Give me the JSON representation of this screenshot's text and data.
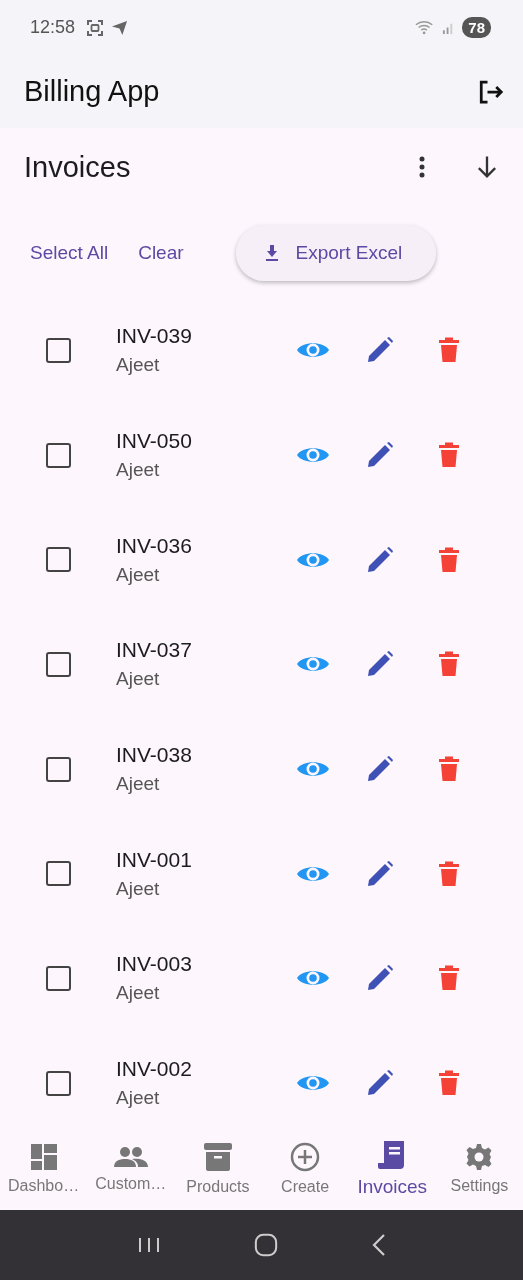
{
  "status_bar": {
    "time": "12:58",
    "battery": "78"
  },
  "app_bar": {
    "title": "Billing App"
  },
  "page": {
    "title": "Invoices"
  },
  "actions": {
    "select_all": "Select All",
    "clear": "Clear",
    "export": "Export Excel"
  },
  "invoices": [
    {
      "number": "INV-039",
      "customer": "Ajeet",
      "checked": false
    },
    {
      "number": "INV-050",
      "customer": "Ajeet",
      "checked": false
    },
    {
      "number": "INV-036",
      "customer": "Ajeet",
      "checked": false
    },
    {
      "number": "INV-037",
      "customer": "Ajeet",
      "checked": false
    },
    {
      "number": "INV-038",
      "customer": "Ajeet",
      "checked": false
    },
    {
      "number": "INV-001",
      "customer": "Ajeet",
      "checked": false
    },
    {
      "number": "INV-003",
      "customer": "Ajeet",
      "checked": false
    },
    {
      "number": "INV-002",
      "customer": "Ajeet",
      "checked": false
    }
  ],
  "bottom_nav": [
    {
      "label": "Dashbo…",
      "kind": "dashboard",
      "selected": false
    },
    {
      "label": "Custom…",
      "kind": "customers",
      "selected": false
    },
    {
      "label": "Products",
      "kind": "products",
      "selected": false
    },
    {
      "label": "Create",
      "kind": "create",
      "selected": false
    },
    {
      "label": "Invoices",
      "kind": "invoices",
      "selected": true
    },
    {
      "label": "Settings",
      "kind": "settings",
      "selected": false
    }
  ]
}
